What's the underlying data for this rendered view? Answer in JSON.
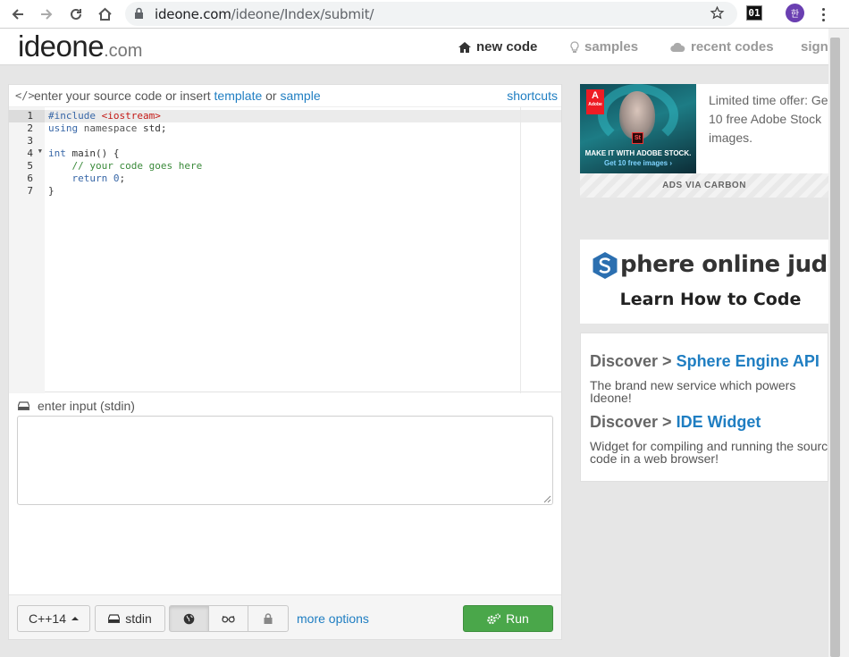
{
  "browser": {
    "url_host": "ideone.com",
    "url_path": "/ideone/Index/submit/",
    "extension_badge": "01",
    "profile_initial": "한"
  },
  "site": {
    "logo_main": "ideone",
    "logo_suffix": ".com",
    "nav": [
      {
        "label": "new code",
        "icon": "home-icon"
      },
      {
        "label": "samples",
        "icon": "lightbulb-icon"
      },
      {
        "label": "recent codes",
        "icon": "cloud-icon"
      },
      {
        "label": "sign",
        "icon": ""
      }
    ]
  },
  "editor": {
    "hint_prefix": "enter your source code or insert",
    "template_link": "template",
    "hint_or": "or",
    "sample_link": "sample",
    "shortcuts_link": "shortcuts",
    "line_numbers": [
      "1",
      "2",
      "3",
      "4",
      "5",
      "6",
      "7"
    ],
    "lines": [
      {
        "segments": [
          {
            "t": "#include ",
            "c": "pp"
          },
          {
            "t": "<iostream>",
            "c": "str"
          }
        ]
      },
      {
        "segments": [
          {
            "t": "using ",
            "c": "kw"
          },
          {
            "t": "namespace ",
            "c": "ns"
          },
          {
            "t": "std;",
            "c": ""
          }
        ]
      },
      {
        "segments": []
      },
      {
        "segments": [
          {
            "t": "int ",
            "c": "kw"
          },
          {
            "t": "main() {",
            "c": ""
          }
        ]
      },
      {
        "segments": [
          {
            "t": "    // your code goes here",
            "c": "cm"
          }
        ]
      },
      {
        "segments": [
          {
            "t": "    ",
            "c": ""
          },
          {
            "t": "return ",
            "c": "kw"
          },
          {
            "t": "0",
            "c": "kw"
          },
          {
            "t": ";",
            "c": ""
          }
        ]
      },
      {
        "segments": [
          {
            "t": "}",
            "c": ""
          }
        ]
      }
    ]
  },
  "stdin": {
    "label": "enter input (stdin)",
    "value": ""
  },
  "toolbar": {
    "language": "C++14",
    "stdin_label": "stdin",
    "more_options": "more options",
    "run_label": "Run"
  },
  "ads": {
    "adobe_brand": "Adobe",
    "adobe_tagline": "MAKE IT WITH ADOBE STOCK.",
    "adobe_cta": "Get 10 free images ›",
    "offer_line1": "Limited time offer: Ge",
    "offer_line2": "10 free Adobe Stock",
    "offer_line3": "images.",
    "via": "ADS VIA CARBON"
  },
  "spoj": {
    "title": "phere online judge",
    "subtitle": "Learn How to Code"
  },
  "discover": [
    {
      "prefix": "Discover > ",
      "link": "Sphere Engine API",
      "line1": "The brand new service which powers",
      "line2": "Ideone!"
    },
    {
      "prefix": "Discover > ",
      "link": "IDE Widget",
      "line1": "Widget for compiling and running the sourc",
      "line2": "code in a web browser!"
    }
  ]
}
